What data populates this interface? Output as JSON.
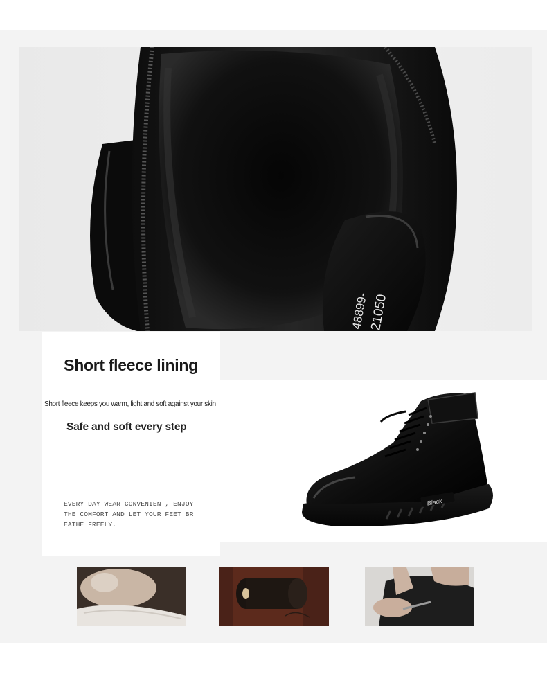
{
  "feature": {
    "title": "Short fleece lining",
    "description": "Short fleece keeps you warm, light and soft against your skin",
    "tagline": "Safe and soft every step",
    "body_lines": [
      "EVERY DAY WEAR CONVENIENT, ENJOY",
      "THE COMFORT AND LET YOUR FEET BR",
      "EATHE FREELY."
    ]
  },
  "boot": {
    "heel_label": "Black",
    "insole_code_1": "21050",
    "insole_code_2": "48899-"
  },
  "thumbnails": [
    {
      "icon": "hands-sanding-icon"
    },
    {
      "icon": "thread-spool-icon"
    },
    {
      "icon": "hands-cutting-leather-icon"
    }
  ]
}
